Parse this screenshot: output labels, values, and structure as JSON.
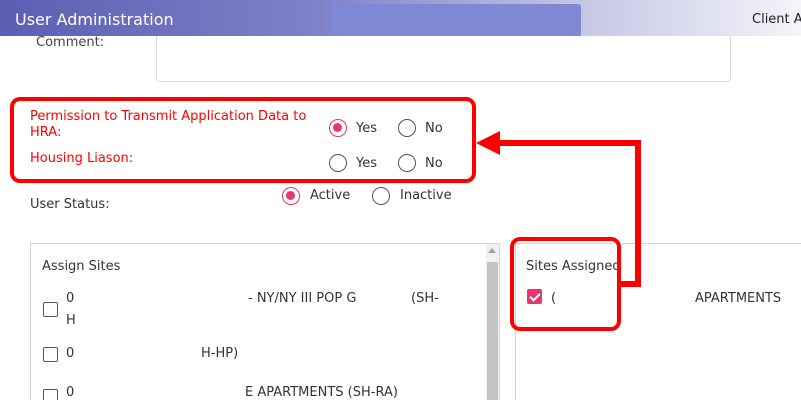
{
  "header": {
    "title": "User Administration",
    "right_text": "Client A"
  },
  "comment": {
    "label": "Comment:",
    "value": ""
  },
  "permission": {
    "label": "Permission to Transmit Application Data to HRA:",
    "yes_label": "Yes",
    "no_label": "No",
    "selected": "Yes"
  },
  "housing_liaison": {
    "label": "Housing Liason:",
    "yes_label": "Yes",
    "no_label": "No",
    "selected": ""
  },
  "user_status": {
    "label": "User Status:",
    "active_label": "Active",
    "inactive_label": "Inactive",
    "selected": "Active"
  },
  "assign_sites": {
    "title": "Assign Sites",
    "items": [
      {
        "col1": "0",
        "col2": "- NY/NY III POP G",
        "col3": "(SH-",
        "wrap": "H",
        "checked": false
      },
      {
        "col1": "0",
        "col2": "H-HP)",
        "col3": "",
        "wrap": "",
        "checked": false
      },
      {
        "col1": "0",
        "col2": "E APARTMENTS (SH-RA)",
        "col3": "",
        "wrap": "",
        "checked": false
      }
    ]
  },
  "sites_assigned": {
    "title": "Sites Assigned",
    "items": [
      {
        "col1": "(",
        "col2": "APARTMENTS",
        "checked": true
      }
    ]
  },
  "colors": {
    "accent": "#e8356a",
    "annotation": "#ff0000",
    "header_start": "#5b5fb3"
  }
}
